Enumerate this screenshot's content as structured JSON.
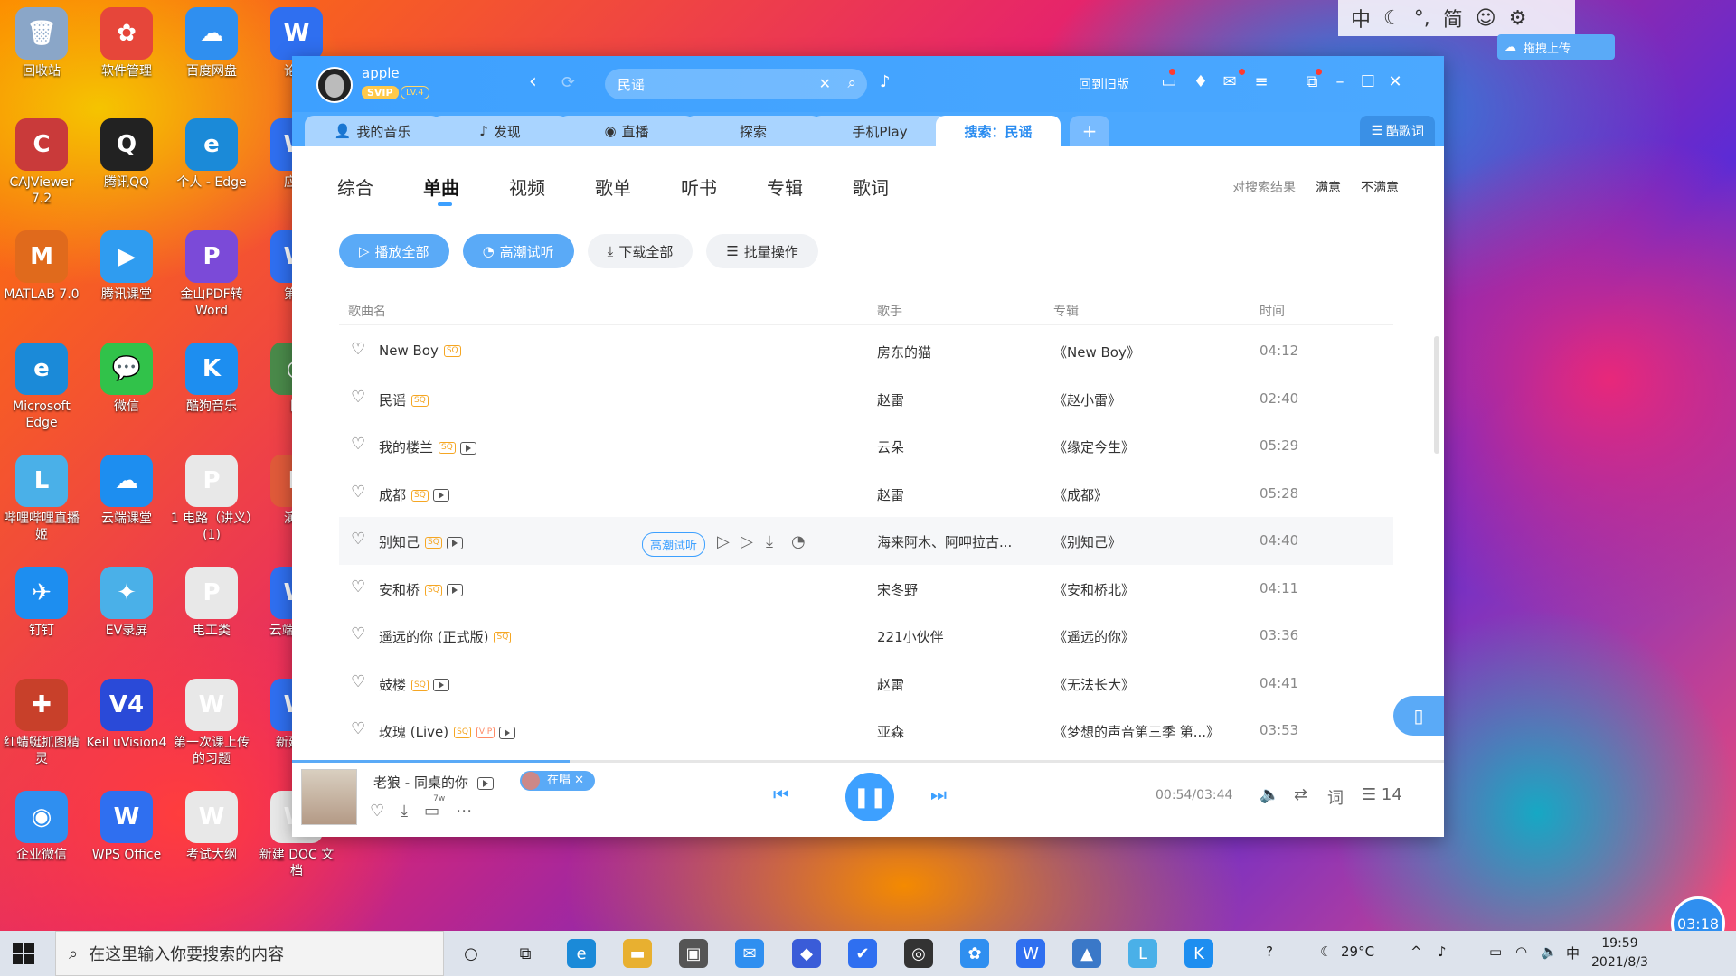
{
  "desktop": {
    "icons": [
      {
        "label": "回收站",
        "color": "#8aa6c8",
        "glyph": "🗑"
      },
      {
        "label": "软件管理",
        "color": "#e6463a",
        "glyph": "✿"
      },
      {
        "label": "百度网盘",
        "color": "#2f8ff0",
        "glyph": "☁"
      },
      {
        "label": "论证",
        "color": "#2f6ff0",
        "glyph": "W"
      },
      {
        "label": "CAJViewer 7.2",
        "color": "#c93a3a",
        "glyph": "C"
      },
      {
        "label": "腾讯QQ",
        "color": "#222222",
        "glyph": "Q"
      },
      {
        "label": "个人 - Edge",
        "color": "#1b8ad8",
        "glyph": "e"
      },
      {
        "label": "应用",
        "color": "#2f6ff0",
        "glyph": "W"
      },
      {
        "label": "MATLAB 7.0",
        "color": "#e06a1c",
        "glyph": "M"
      },
      {
        "label": "腾讯课堂",
        "color": "#2f9cf0",
        "glyph": "▶"
      },
      {
        "label": "金山PDF转Word",
        "color": "#7b4ad8",
        "glyph": "P"
      },
      {
        "label": "第一",
        "color": "#2f6ff0",
        "glyph": "W"
      },
      {
        "label": "Microsoft Edge",
        "color": "#1b8ad8",
        "glyph": "e"
      },
      {
        "label": "微信",
        "color": "#31c24a",
        "glyph": "💬"
      },
      {
        "label": "酷狗音乐",
        "color": "#1d8ef0",
        "glyph": "K"
      },
      {
        "label": "图",
        "color": "#4a8a4a",
        "glyph": "◎"
      },
      {
        "label": "哔哩哔哩直播姬",
        "color": "#4ab0e8",
        "glyph": "L"
      },
      {
        "label": "云端课堂",
        "color": "#1d8ef0",
        "glyph": "☁"
      },
      {
        "label": "1 电路（讲义）(1)",
        "color": "#e8e8e8",
        "glyph": "P"
      },
      {
        "label": "演示",
        "color": "#e05a3a",
        "glyph": "P"
      },
      {
        "label": "钉钉",
        "color": "#1d8ef0",
        "glyph": "✈"
      },
      {
        "label": "EV录屏",
        "color": "#4ab0e8",
        "glyph": "✦"
      },
      {
        "label": "电工类",
        "color": "#e8e8e8",
        "glyph": "P"
      },
      {
        "label": "云端 考试",
        "color": "#2f6ff0",
        "glyph": "W"
      },
      {
        "label": "红蜻蜓抓图精灵",
        "color": "#c8402a",
        "glyph": "✚"
      },
      {
        "label": "Keil uVision4",
        "color": "#2a4ad8",
        "glyph": "V4"
      },
      {
        "label": "第一次课上传的习题",
        "color": "#e8e8e8",
        "glyph": "W"
      },
      {
        "label": "新建 文",
        "color": "#2f6ff0",
        "glyph": "W"
      },
      {
        "label": "企业微信",
        "color": "#2f8ff0",
        "glyph": "◉"
      },
      {
        "label": "WPS Office",
        "color": "#2f6ff0",
        "glyph": "W"
      },
      {
        "label": "考试大纲",
        "color": "#e8e8e8",
        "glyph": "W"
      },
      {
        "label": "新建 DOC 文档",
        "color": "#e8e8e8",
        "glyph": "W"
      }
    ]
  },
  "ime": {
    "items": [
      "中",
      "☾",
      "°,",
      "简",
      "☺",
      "⚙"
    ],
    "upload_label": "拖拽上传"
  },
  "app": {
    "user": {
      "name": "apple",
      "svip": "SVIP",
      "level": "LV.4"
    },
    "search": {
      "value": "民谣",
      "placeholder": ""
    },
    "old_version": "回到旧版",
    "tabs": [
      {
        "label": "我的音乐",
        "icon": "person-icon"
      },
      {
        "label": "发现",
        "icon": "note-icon"
      },
      {
        "label": "直播",
        "icon": "live-icon"
      },
      {
        "label": "探索",
        "icon": ""
      },
      {
        "label": "手机Play",
        "icon": ""
      },
      {
        "label": "搜索：民谣",
        "icon": ""
      }
    ],
    "lyric_label": "酷歌词",
    "categories": [
      "综合",
      "单曲",
      "视频",
      "歌单",
      "听书",
      "专辑",
      "歌词"
    ],
    "active_category": "单曲",
    "feedback": {
      "prompt": "对搜索结果",
      "yes": "满意",
      "no": "不满意"
    },
    "actions": {
      "play_all": "播放全部",
      "highlight": "高潮试听",
      "download_all": "下载全部",
      "batch": "批量操作"
    },
    "columns": {
      "song": "歌曲名",
      "artist": "歌手",
      "album": "专辑",
      "time": "时间"
    },
    "hover_highlight_label": "高潮试听",
    "songs": [
      {
        "title": "New Boy",
        "sq": true,
        "vip": false,
        "mv": false,
        "artist": "房东的猫",
        "album": "《New Boy》",
        "time": "04:12"
      },
      {
        "title": "民谣",
        "sq": true,
        "vip": false,
        "mv": false,
        "artist": "赵雷",
        "album": "《赵小雷》",
        "time": "02:40"
      },
      {
        "title": "我的楼兰",
        "sq": true,
        "vip": false,
        "mv": true,
        "artist": "云朵",
        "album": "《缘定今生》",
        "time": "05:29"
      },
      {
        "title": "成都",
        "sq": true,
        "vip": false,
        "mv": true,
        "artist": "赵雷",
        "album": "《成都》",
        "time": "05:28"
      },
      {
        "title": "别知己",
        "sq": true,
        "vip": false,
        "mv": true,
        "artist": "海来阿木、阿呷拉古...",
        "album": "《别知己》",
        "time": "04:40"
      },
      {
        "title": "安和桥",
        "sq": true,
        "vip": false,
        "mv": true,
        "artist": "宋冬野",
        "album": "《安和桥北》",
        "time": "04:11"
      },
      {
        "title": "遥远的你 (正式版)",
        "sq": true,
        "vip": false,
        "mv": false,
        "artist": "221小伙伴",
        "album": "《遥远的你》",
        "time": "03:36"
      },
      {
        "title": "鼓楼",
        "sq": true,
        "vip": false,
        "mv": true,
        "artist": "赵雷",
        "album": "《无法长大》",
        "time": "04:41"
      },
      {
        "title": "玫瑰 (Live)",
        "sq": true,
        "vip": true,
        "mv": true,
        "artist": "亚森",
        "album": "《梦想的声音第三季 第...》",
        "time": "03:53"
      }
    ],
    "player": {
      "title": "老狼 - 同桌的你",
      "singing_label": "在唱",
      "comment_count": "7w",
      "elapsed": "00:54",
      "duration": "03:44",
      "time_text": "00:54/03:44",
      "progress_fraction": 0.241,
      "lyric_btn": "词",
      "playlist_count": "14"
    }
  },
  "taskbar": {
    "search_placeholder": "在这里输入你要搜索的内容",
    "weather": "29°C",
    "ime": "中",
    "time": "19:59",
    "date": "2021/8/3"
  },
  "bubble_time": "03:18",
  "colors": {
    "accent": "#3da0ff",
    "header": "#4ba8ff",
    "sq_badge": "#f5a623"
  }
}
